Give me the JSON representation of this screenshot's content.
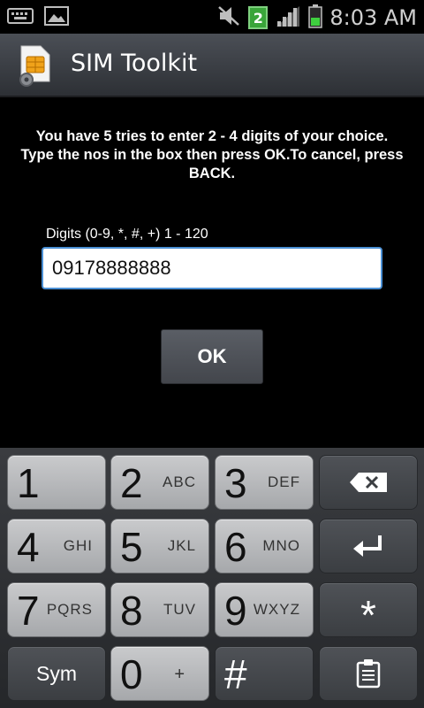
{
  "status_bar": {
    "time": "8:03 AM",
    "sim_number": "2"
  },
  "title_bar": {
    "title": "SIM Toolkit"
  },
  "prompt": {
    "message": "You have 5 tries to enter 2 - 4 digits of your choice. Type the nos in the box then press OK.To cancel, press BACK.",
    "input_label": "Digits (0-9, *, #, +) 1 - 120",
    "input_value": "09178888888",
    "ok_label": "OK"
  },
  "keyboard": {
    "keys": [
      {
        "main": "1",
        "sub": ""
      },
      {
        "main": "2",
        "sub": "ABC"
      },
      {
        "main": "3",
        "sub": "DEF"
      },
      {
        "main": "4",
        "sub": "GHI"
      },
      {
        "main": "5",
        "sub": "JKL"
      },
      {
        "main": "6",
        "sub": "MNO"
      },
      {
        "main": "7",
        "sub": "PQRS"
      },
      {
        "main": "8",
        "sub": "TUV"
      },
      {
        "main": "9",
        "sub": "WXYZ"
      },
      {
        "main": "0",
        "sub": "+"
      },
      {
        "main": "#",
        "sub": ""
      }
    ],
    "sym_label": "Sym",
    "star_label": "*",
    "icons": {
      "backspace": "backspace-icon",
      "enter": "enter-icon",
      "clipboard": "clipboard-icon"
    }
  }
}
